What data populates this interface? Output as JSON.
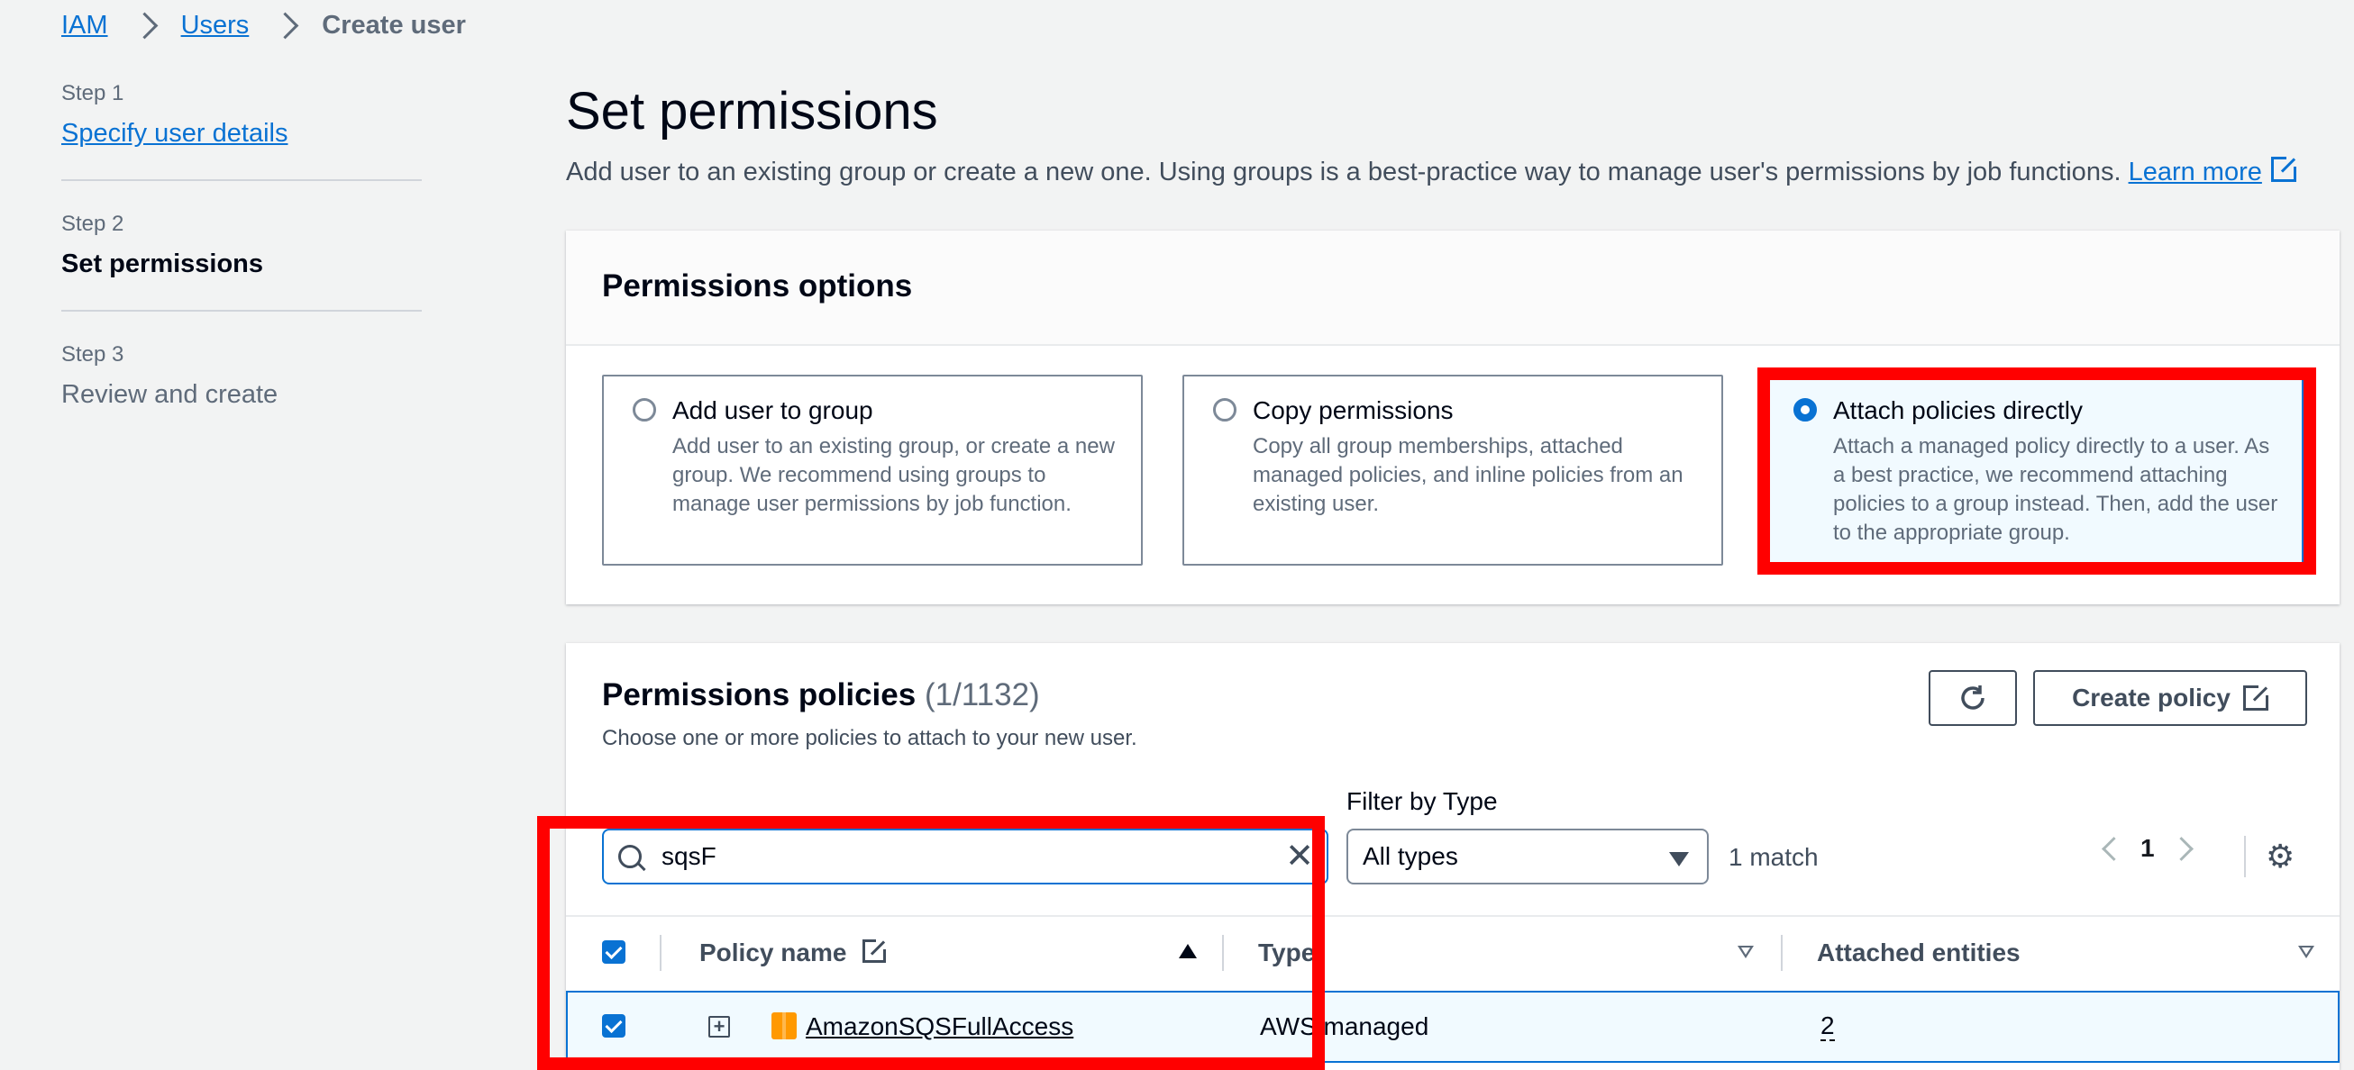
{
  "breadcrumb": {
    "items": [
      "IAM",
      "Users"
    ],
    "current": "Create user"
  },
  "steps": [
    {
      "num": "Step 1",
      "label": "Specify user details"
    },
    {
      "num": "Step 2",
      "label": "Set permissions"
    },
    {
      "num": "Step 3",
      "label": "Review and create"
    }
  ],
  "header": {
    "title": "Set permissions",
    "description": "Add user to an existing group or create a new one. Using groups is a best-practice way to manage user's permissions by job functions.",
    "learn_more": "Learn more"
  },
  "options_panel": {
    "title": "Permissions options",
    "options": [
      {
        "title": "Add user to group",
        "desc": "Add user to an existing group, or create a new group. We recommend using groups to manage user permissions by job function.",
        "selected": false
      },
      {
        "title": "Copy permissions",
        "desc": "Copy all group memberships, attached managed policies, and inline policies from an existing user.",
        "selected": false
      },
      {
        "title": "Attach policies directly",
        "desc": "Attach a managed policy directly to a user. As a best practice, we recommend attaching policies to a group instead. Then, add the user to the appropriate group.",
        "selected": true
      }
    ]
  },
  "policies_panel": {
    "title": "Permissions policies",
    "count": "(1/1132)",
    "subtitle": "Choose one or more policies to attach to your new user.",
    "create_policy": "Create policy",
    "filter_label": "Filter by Type",
    "search_value": "sqsF",
    "type_select": "All types",
    "match_text": "1 match",
    "page": "1",
    "columns": {
      "policy_name": "Policy name",
      "type": "Type",
      "attached": "Attached entities"
    },
    "rows": [
      {
        "name": "AmazonSQSFullAccess",
        "type": "AWS managed",
        "attached": "2",
        "checked": true
      }
    ]
  },
  "colors": {
    "accent": "#0972d3",
    "highlight": "#ff0000"
  }
}
